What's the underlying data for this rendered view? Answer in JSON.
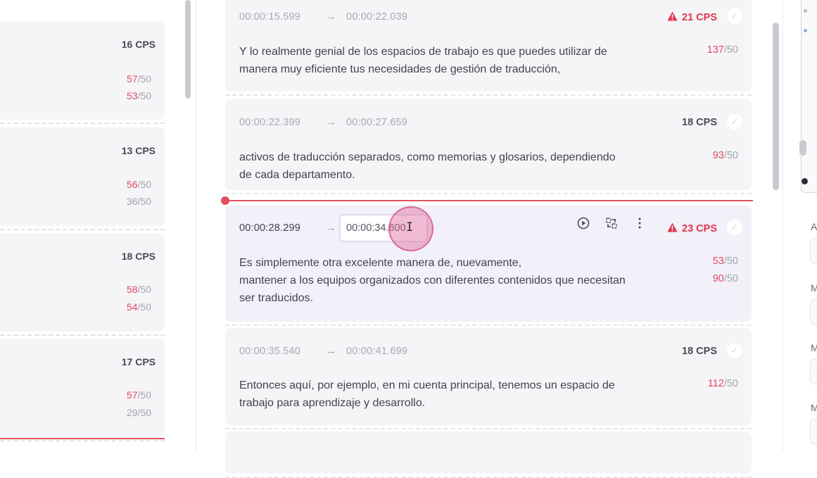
{
  "left_cards": [
    {
      "cps": "16 CPS",
      "counts": [
        {
          "value": "57",
          "max": "/50",
          "over": true
        },
        {
          "value": "53",
          "max": "/50",
          "over": true
        }
      ]
    },
    {
      "cps": "13 CPS",
      "counts": [
        {
          "value": "56",
          "max": "/50",
          "over": true
        },
        {
          "value": "36",
          "max": "/50",
          "over": false
        }
      ]
    },
    {
      "cps": "18 CPS",
      "counts": [
        {
          "value": "58",
          "max": "/50",
          "over": true
        },
        {
          "value": "54",
          "max": "/50",
          "over": true
        }
      ]
    },
    {
      "cps": "17 CPS",
      "counts": [
        {
          "value": "57",
          "max": "/50",
          "over": true
        },
        {
          "value": "29",
          "max": "/50",
          "over": false
        }
      ]
    }
  ],
  "segments": [
    {
      "start": "00:00:15.599",
      "arrow": "→",
      "end": "00:00:22.039",
      "cps": "21 CPS",
      "cps_warning": true,
      "lines": [
        "Y lo realmente genial de los espacios de trabajo es que puedes utilizar de\nmanera muy eficiente tus necesidades de gestión de traducción,"
      ],
      "counts": [
        {
          "value": "137",
          "max": "/50"
        }
      ]
    },
    {
      "start": "00:00:22.399",
      "arrow": "→",
      "end": "00:00:27.659",
      "cps": "18 CPS",
      "cps_warning": false,
      "lines": [
        "activos de traducción separados, como memorias y glosarios, dependiendo\nde cada departamento."
      ],
      "counts": [
        {
          "value": "93",
          "max": "/50"
        }
      ]
    },
    {
      "start": "00:00:28.299",
      "arrow": "→",
      "end_input_value": "00:00:34.600",
      "cps": "23 CPS",
      "cps_warning": true,
      "active": true,
      "lines": [
        "Es simplemente otra excelente manera de, nuevamente,",
        "mantener a los equipos organizados con diferentes contenidos que necesitan\nser traducidos."
      ],
      "counts": [
        {
          "value": "53",
          "max": "/50"
        },
        {
          "value": "90",
          "max": "/50"
        }
      ]
    },
    {
      "start": "00:00:35.540",
      "arrow": "→",
      "end": "00:00:41.699",
      "cps": "18 CPS",
      "cps_warning": false,
      "lines": [
        "Entonces aquí, por ejemplo, en mi cuenta principal, tenemos un espacio de\ntrabajo para aprendizaje y desarrollo."
      ],
      "counts": [
        {
          "value": "112",
          "max": "/50"
        }
      ]
    }
  ],
  "right_panel": {
    "labels": [
      "A",
      "M",
      "M",
      "M"
    ]
  },
  "colors": {
    "warning": "#e0354b",
    "over_limit": "#e14a5f",
    "timeline_marker": "#e0535f",
    "card_bg": "#f5f4f7",
    "active_card_bg": "#f2f0f8"
  }
}
